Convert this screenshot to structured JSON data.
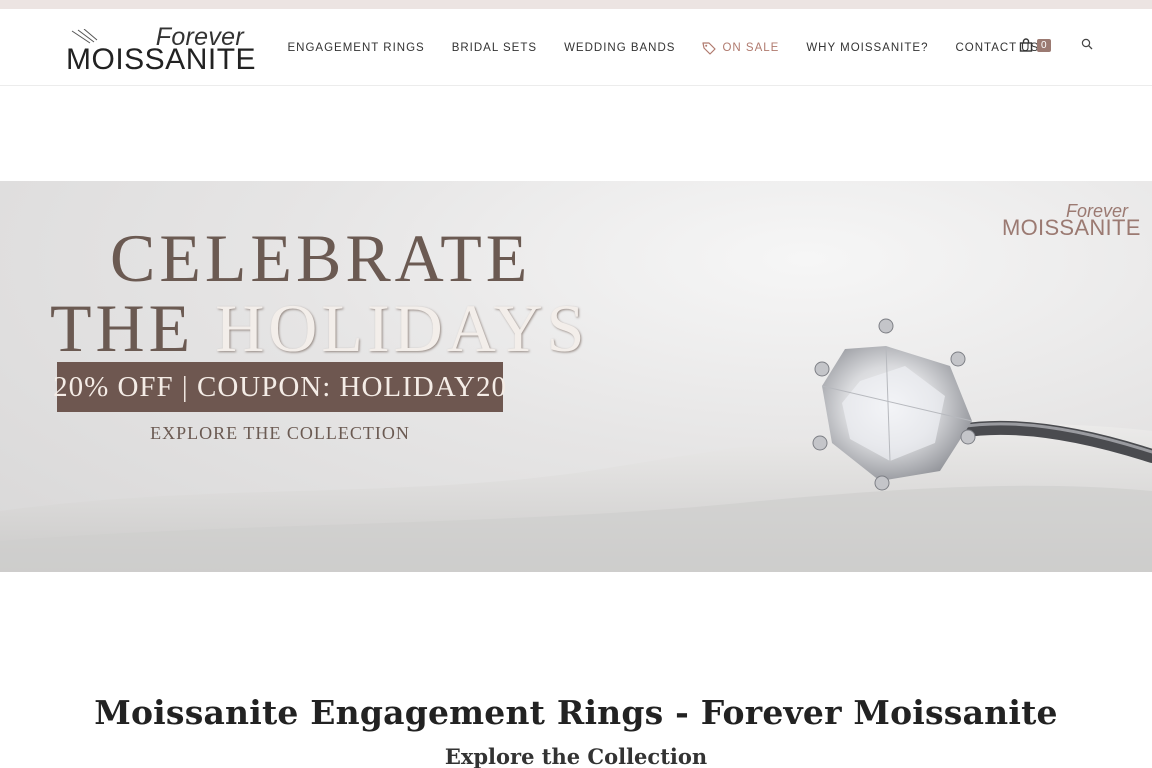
{
  "logo": {
    "top": "Forever",
    "bottom": "MOISSANITE"
  },
  "nav": {
    "items": [
      {
        "label": "ENGAGEMENT RINGS"
      },
      {
        "label": "BRIDAL SETS"
      },
      {
        "label": "WEDDING BANDS"
      },
      {
        "label": "ON SALE",
        "icon": "tag-icon"
      },
      {
        "label": "WHY MOISSANITE?"
      },
      {
        "label": "CONTACT US"
      }
    ],
    "cart_count": "0",
    "cart_icon": "shopping-bag-icon",
    "search_icon": "search-icon"
  },
  "hero": {
    "line1": "CELEBRATE",
    "line2_dark": "THE ",
    "line2_light": "HOLIDAYS",
    "coupon": "20% OFF | COUPON: HOLIDAY20",
    "cta": "EXPLORE THE COLLECTION",
    "logo_top": "Forever",
    "logo_bottom": "MOISSANITE"
  },
  "main": {
    "heading": "Moissanite Engagement Rings - Forever Moissanite",
    "subheading": "Explore the Collection"
  },
  "colors": {
    "accent": "#9b7a72",
    "coupon_bg": "#6e5750",
    "hero_text": "#6b5a52",
    "top_strip": "#ece4e2"
  }
}
